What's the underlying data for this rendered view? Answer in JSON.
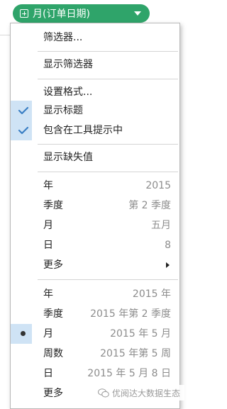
{
  "field_pill": {
    "label": "月(订单日期)"
  },
  "menu": {
    "filter": "筛选器...",
    "show_filter": "显示筛选器",
    "format": "设置格式...",
    "show_title": "显示标题",
    "include_tooltip": "包含在工具提示中",
    "show_missing": "显示缺失值",
    "discrete": [
      {
        "label": "年",
        "value": "2015"
      },
      {
        "label": "季度",
        "value": "第 2 季度"
      },
      {
        "label": "月",
        "value": "五月"
      },
      {
        "label": "日",
        "value": "8"
      },
      {
        "label": "更多",
        "value": ""
      }
    ],
    "continuous": [
      {
        "label": "年",
        "value": "2015 年"
      },
      {
        "label": "季度",
        "value": "2015 年第 2 季度"
      },
      {
        "label": "月",
        "value": "2015 年 5 月"
      },
      {
        "label": "周数",
        "value": "2015 年第 5 周"
      },
      {
        "label": "日",
        "value": "2015 年 5 月 8 日"
      },
      {
        "label": "更多",
        "value": ""
      }
    ],
    "selected_continuous": "月"
  },
  "watermark": {
    "text": "优阅达大数据生态"
  },
  "colors": {
    "pill": "#2fa46a",
    "check": "#3a7fc4",
    "check_bg": "#cfe3f5",
    "value_text": "#8c8c8c"
  }
}
